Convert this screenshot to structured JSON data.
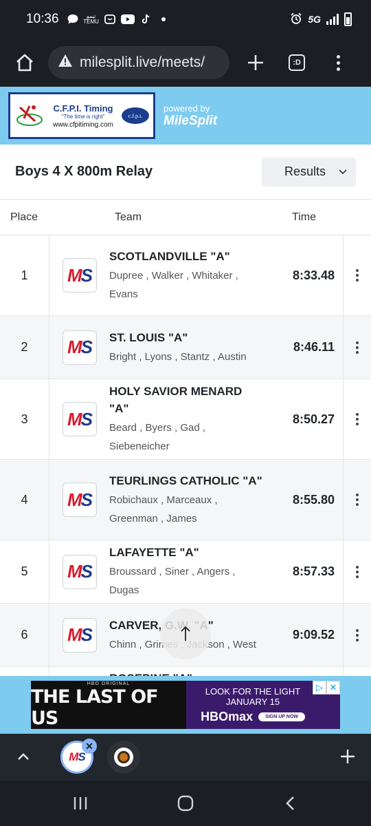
{
  "status": {
    "time": "10:36",
    "temu_label": "ﺗﯿﻤﻮ TEMU",
    "network": "5G"
  },
  "browser": {
    "url": "milesplit.live/meets/",
    "tab_count": ":D"
  },
  "banner": {
    "brand": "C.F.P.I. Timing",
    "motto": "\"The time is right\"",
    "site": "www.cfpitiming.com",
    "oval": "c.f.p.i.",
    "powered_by": "powered by",
    "powered_brand": "MileSplit"
  },
  "event": {
    "title": "Boys 4 X 800m Relay",
    "view_select": "Results"
  },
  "table": {
    "headers": {
      "place": "Place",
      "team": "Team",
      "time": "Time"
    },
    "rows": [
      {
        "place": "1",
        "team": "SCOTLANDVILLE \"A\"",
        "athletes": "Dupree , Walker , Whitaker , Evans",
        "time": "8:33.48"
      },
      {
        "place": "2",
        "team": "ST. LOUIS \"A\"",
        "athletes": "Bright , Lyons , Stantz , Austin",
        "time": "8:46.11"
      },
      {
        "place": "3",
        "team": "HOLY SAVIOR MENARD \"A\"",
        "athletes": "Beard , Byers , Gad , Siebeneicher",
        "time": "8:50.27"
      },
      {
        "place": "4",
        "team": "TEURLINGS CATHOLIC \"A\"",
        "athletes": "Robichaux , Marceaux , Greenman , James",
        "time": "8:55.80"
      },
      {
        "place": "5",
        "team": "LAFAYETTE \"A\"",
        "athletes": "Broussard , Siner , Angers , Dugas",
        "time": "8:57.33"
      },
      {
        "place": "6",
        "team": "CARVER, G.W. \"A\"",
        "athletes": "Chinn , Grimes , Jackson , West",
        "time": "9:09.52"
      },
      {
        "place": "",
        "team": "ROSEPINE \"A\"",
        "athletes": "",
        "time": ""
      }
    ]
  },
  "ad": {
    "small": "HBO ORIGINAL",
    "title": "THE LAST OF US",
    "line1": "LOOK FOR THE LIGHT",
    "line2": "JANUARY 15",
    "brand": "HBOmax",
    "cta": "SIGN UP NOW"
  },
  "tabs": {
    "ms_label": "MS"
  }
}
